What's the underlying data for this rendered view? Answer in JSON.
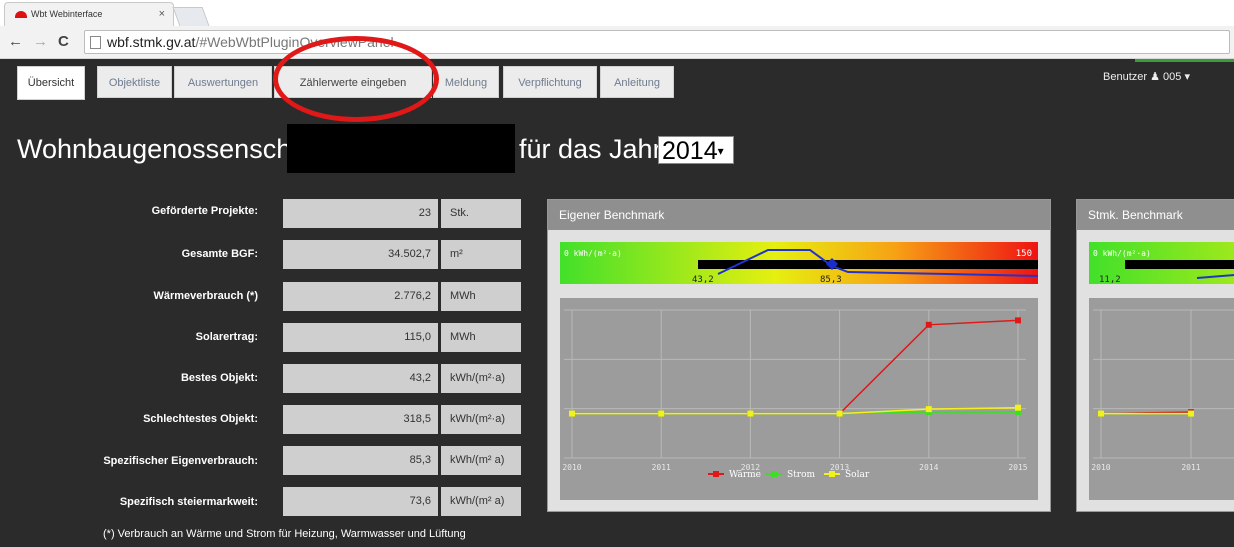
{
  "browser": {
    "tab_title": "Wbt Webinterface",
    "url_host": "wbf.stmk.gv.at",
    "url_path": "/#WebWbtPluginOverviewPanel"
  },
  "nav": {
    "tabs": [
      "Übersicht",
      "Objektliste",
      "Auswertungen",
      "Zählerwerte eingeben",
      "Meldung",
      "Verpflichtung",
      "Anleitung"
    ],
    "user_label": "Benutzer",
    "user_id": "005"
  },
  "header": {
    "title_prefix": "Wohnbaugenossenschaft",
    "title_suffix": "für das Jahr",
    "year": "2014"
  },
  "stats": [
    {
      "label": "Geförderte Projekte:",
      "value": "23",
      "unit": "Stk."
    },
    {
      "label": "Gesamte BGF:",
      "value": "34.502,7",
      "unit": "m²"
    },
    {
      "label": "Wärmeverbrauch (*)",
      "value": "2.776,2",
      "unit": "MWh"
    },
    {
      "label": "Solarertrag:",
      "value": "115,0",
      "unit": "MWh"
    },
    {
      "label": "Bestes Objekt:",
      "value": "43,2",
      "unit": "kWh/(m²·a)"
    },
    {
      "label": "Schlechtestes Objekt:",
      "value": "318,5",
      "unit": "kWh/(m²·a)"
    },
    {
      "label": "Spezifischer Eigenverbrauch:",
      "value": "85,3",
      "unit": "kWh/(m² a)"
    },
    {
      "label": "Spezifisch steiermarkweit:",
      "value": "73,6",
      "unit": "kWh/(m² a)"
    }
  ],
  "footnote": "(*) Verbrauch an Wärme und Strom für Heizung, Warmwasser und Lüftung",
  "panels": {
    "own_title": "Eigener Benchmark",
    "stmk_title": "Stmk. Benchmark"
  },
  "benchmark": {
    "own": {
      "scale_min_label": "0 kWh/(m²·a)",
      "scale_max_label": "150",
      "best": "43,2",
      "own": "85,3"
    },
    "stmk": {
      "scale_min_label": "0 kWh/(m²·a)",
      "best": "11,2"
    }
  },
  "colors": {
    "waerme": "#e01818",
    "strom": "#3fdc28",
    "solar": "#f2f21a",
    "accent_red": "#e01818"
  },
  "chart_data": [
    {
      "type": "line",
      "title": "Eigener Benchmark",
      "x": [
        "2010",
        "2011",
        "2012",
        "2013",
        "2014",
        "2015"
      ],
      "series": [
        {
          "name": "Wärme",
          "values": [
            0.3,
            0.3,
            0.3,
            0.3,
            0.9,
            0.93
          ]
        },
        {
          "name": "Strom",
          "values": [
            0.3,
            0.3,
            0.3,
            0.3,
            0.31,
            0.31
          ]
        },
        {
          "name": "Solar",
          "values": [
            0.3,
            0.3,
            0.3,
            0.3,
            0.33,
            0.34
          ]
        }
      ],
      "legend": "bottom-center",
      "grid": true
    },
    {
      "type": "line",
      "title": "Stmk. Benchmark",
      "x": [
        "2010",
        "2011"
      ],
      "series": [
        {
          "name": "Wärme",
          "values": [
            0.3,
            0.31
          ]
        },
        {
          "name": "Strom",
          "values": [
            0.3,
            0.3
          ]
        },
        {
          "name": "Solar",
          "values": [
            0.3,
            0.3
          ]
        }
      ],
      "grid": true
    }
  ]
}
